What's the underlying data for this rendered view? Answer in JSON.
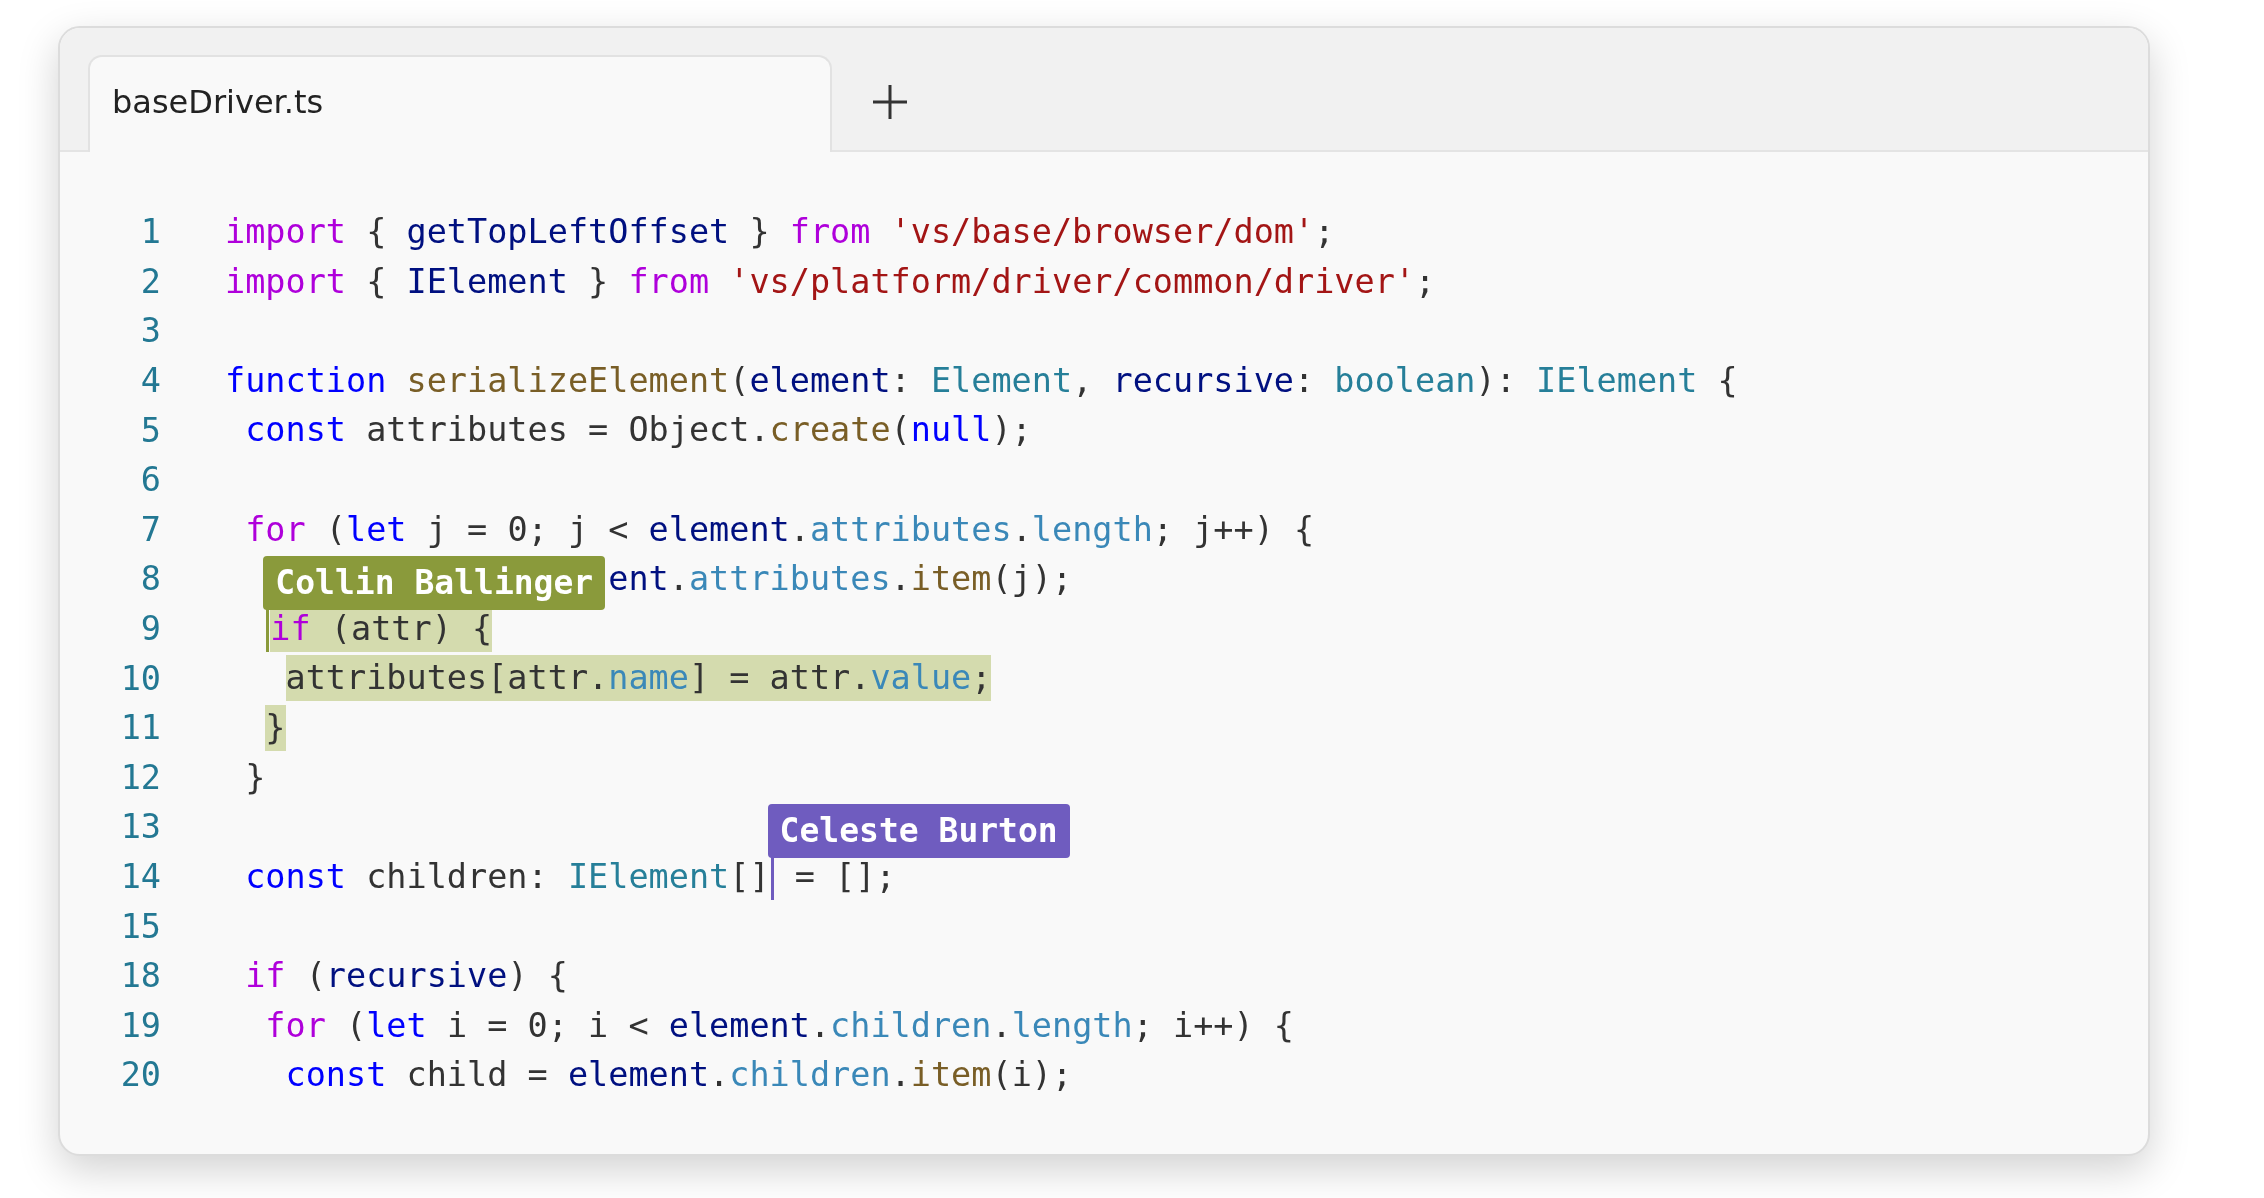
{
  "tabs": [
    {
      "label": "baseDriver.ts",
      "selected": true
    }
  ],
  "editor": {
    "lines": [
      {
        "number": "1",
        "tokens": [
          {
            "text": "import",
            "kind": "keyword"
          },
          {
            "text": " { ",
            "kind": "plain"
          },
          {
            "text": "getTopLeftOffset",
            "kind": "variable"
          },
          {
            "text": " } ",
            "kind": "plain"
          },
          {
            "text": "from",
            "kind": "keyword"
          },
          {
            "text": " 'vs/base/browser/dom'",
            "kind": "string"
          },
          {
            "text": ";",
            "kind": "plain"
          }
        ]
      },
      {
        "number": "2",
        "tokens": [
          {
            "text": "import",
            "kind": "keyword"
          },
          {
            "text": " { ",
            "kind": "plain"
          },
          {
            "text": "IElement",
            "kind": "variable"
          },
          {
            "text": " } ",
            "kind": "plain"
          },
          {
            "text": "from",
            "kind": "keyword"
          },
          {
            "text": " 'vs/platform/driver/common/driver'",
            "kind": "string"
          },
          {
            "text": ";",
            "kind": "plain"
          }
        ]
      },
      {
        "number": "3"
      },
      {
        "number": "4",
        "tokens": [
          {
            "text": "function",
            "kind": "storage"
          },
          {
            "text": " serializeElement",
            "kind": "function"
          },
          {
            "text": "(",
            "kind": "plain"
          },
          {
            "text": "element",
            "kind": "variable"
          },
          {
            "text": ": ",
            "kind": "plain"
          },
          {
            "text": "Element",
            "kind": "type"
          },
          {
            "text": ", ",
            "kind": "plain"
          },
          {
            "text": "recursive",
            "kind": "variable"
          },
          {
            "text": ": ",
            "kind": "plain"
          },
          {
            "text": "boolean",
            "kind": "type"
          },
          {
            "text": "): ",
            "kind": "plain"
          },
          {
            "text": "IElement",
            "kind": "type"
          },
          {
            "text": " {",
            "kind": "plain"
          }
        ]
      },
      {
        "number": "5",
        "tokens": [
          {
            "text": " const",
            "kind": "storage"
          },
          {
            "text": " attributes = Object.",
            "kind": "plain"
          },
          {
            "text": "create",
            "kind": "function"
          },
          {
            "text": "(",
            "kind": "plain"
          },
          {
            "text": "null",
            "kind": "storage"
          },
          {
            "text": ");",
            "kind": "plain"
          }
        ]
      },
      {
        "number": "6"
      },
      {
        "number": "7",
        "tokens": [
          {
            "text": " for",
            "kind": "keyword"
          },
          {
            "text": " (",
            "kind": "plain"
          },
          {
            "text": "let",
            "kind": "storage"
          },
          {
            "text": " j = 0; j < ",
            "kind": "plain"
          },
          {
            "text": "element",
            "kind": "variable"
          },
          {
            "text": ".",
            "kind": "plain"
          },
          {
            "text": "attributes",
            "kind": "property"
          },
          {
            "text": ".",
            "kind": "plain"
          },
          {
            "text": "length",
            "kind": "property"
          },
          {
            "text": "; j++) {",
            "kind": "plain"
          }
        ]
      },
      {
        "number": "8",
        "tokens": [
          {
            "text": "                   ent",
            "kind": "variable"
          },
          {
            "text": ".",
            "kind": "plain"
          },
          {
            "text": "attributes",
            "kind": "property"
          },
          {
            "text": ".",
            "kind": "plain"
          },
          {
            "text": "item",
            "kind": "function"
          },
          {
            "text": "(j);",
            "kind": "plain"
          }
        ]
      },
      {
        "number": "9",
        "tokens": [
          {
            "kind": "cursor",
            "name": "Collin Ballinger",
            "color": "#8a9a3b"
          },
          {
            "text": "  if",
            "kind": "keyword",
            "highlighted": true
          },
          {
            "text": " (attr) {",
            "kind": "plain",
            "highlighted": true
          }
        ]
      },
      {
        "number": "10",
        "tokens": [
          {
            "text": "   attributes[attr.",
            "kind": "plain",
            "highlighted": true
          },
          {
            "text": "name",
            "kind": "property",
            "highlighted": true
          },
          {
            "text": "] = attr.",
            "kind": "plain",
            "highlighted": true
          },
          {
            "text": "value",
            "kind": "property",
            "highlighted": true
          },
          {
            "text": ";",
            "kind": "plain",
            "highlighted": true
          }
        ]
      },
      {
        "number": "11",
        "tokens": [
          {
            "text": "  }",
            "kind": "plain",
            "highlighted": true
          }
        ]
      },
      {
        "number": "12",
        "tokens": [
          {
            "text": " }",
            "kind": "plain"
          }
        ]
      },
      {
        "number": "13"
      },
      {
        "number": "14",
        "tokens": [
          {
            "text": " const",
            "kind": "storage"
          },
          {
            "text": " children: ",
            "kind": "plain"
          },
          {
            "text": "IElement",
            "kind": "type"
          },
          {
            "text": "[]",
            "kind": "plain"
          },
          {
            "kind": "cursor",
            "name": "Celeste Burton",
            "color": "#6f5cbf"
          },
          {
            "text": " = [];",
            "kind": "plain"
          }
        ]
      },
      {
        "number": "15"
      },
      {
        "number": "18",
        "tokens": [
          {
            "text": " if",
            "kind": "keyword"
          },
          {
            "text": " (",
            "kind": "plain"
          },
          {
            "text": "recursive",
            "kind": "variable"
          },
          {
            "text": ") {",
            "kind": "plain"
          }
        ]
      },
      {
        "number": "19",
        "tokens": [
          {
            "text": "  for",
            "kind": "keyword"
          },
          {
            "text": " (",
            "kind": "plain"
          },
          {
            "text": "let",
            "kind": "storage"
          },
          {
            "text": " i = 0; i < ",
            "kind": "plain"
          },
          {
            "text": "element",
            "kind": "variable"
          },
          {
            "text": ".",
            "kind": "plain"
          },
          {
            "text": "children",
            "kind": "property"
          },
          {
            "text": ".",
            "kind": "plain"
          },
          {
            "text": "length",
            "kind": "property"
          },
          {
            "text": "; i++) {",
            "kind": "plain"
          }
        ]
      },
      {
        "number": "20",
        "tokens": [
          {
            "text": "   const",
            "kind": "storage"
          },
          {
            "text": " child = ",
            "kind": "plain"
          },
          {
            "text": "element",
            "kind": "variable"
          },
          {
            "text": ".",
            "kind": "plain"
          },
          {
            "text": "children",
            "kind": "property"
          },
          {
            "text": ".",
            "kind": "plain"
          },
          {
            "text": "item",
            "kind": "function"
          },
          {
            "text": "(i);",
            "kind": "plain"
          }
        ]
      }
    ]
  }
}
